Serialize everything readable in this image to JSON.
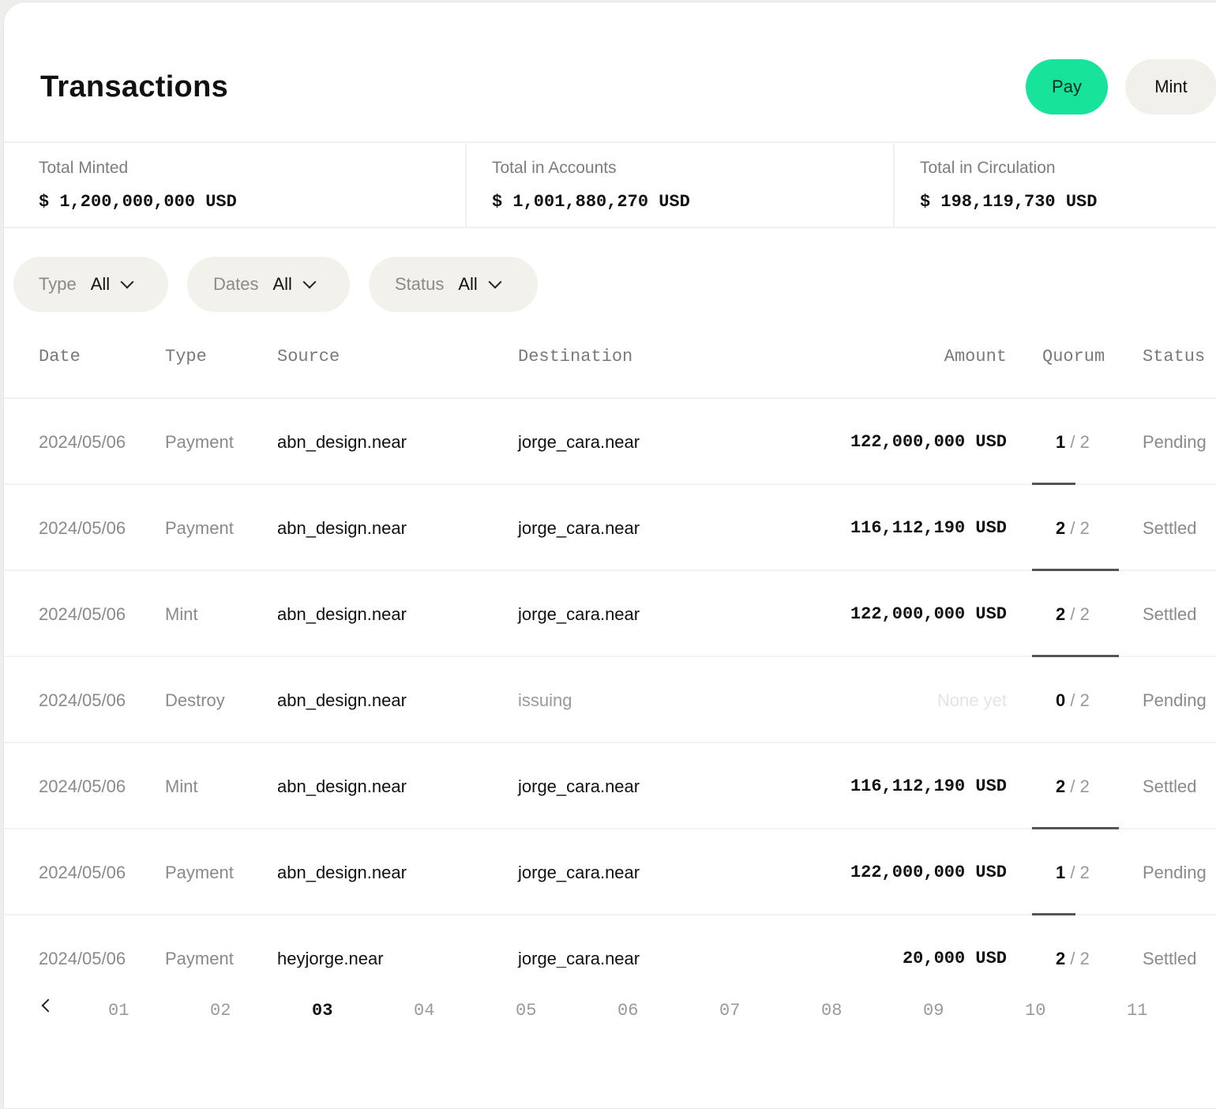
{
  "header": {
    "title": "Transactions",
    "pay_label": "Pay",
    "mint_label": "Mint"
  },
  "stats": [
    {
      "label": "Total Minted",
      "value": "$ 1,200,000,000 USD"
    },
    {
      "label": "Total in Accounts",
      "value": "$ 1,001,880,270 USD"
    },
    {
      "label": "Total in Circulation",
      "value": "$ 198,119,730 USD"
    }
  ],
  "filters": [
    {
      "label": "Type",
      "value": "All"
    },
    {
      "label": "Dates",
      "value": "All"
    },
    {
      "label": "Status",
      "value": "All"
    }
  ],
  "columns": {
    "date": "Date",
    "type": "Type",
    "source": "Source",
    "destination": "Destination",
    "amount": "Amount",
    "quorum": "Quorum",
    "status": "Status"
  },
  "rows": [
    {
      "date": "2024/05/06",
      "type": "Payment",
      "source": "abn_design.near",
      "destination": "jorge_cara.near",
      "amount": "122,000,000 USD",
      "quorum_num": "1",
      "quorum_den": "/ 2",
      "quorum_fraction": 0.5,
      "status": "Pending"
    },
    {
      "date": "2024/05/06",
      "type": "Payment",
      "source": "abn_design.near",
      "destination": "jorge_cara.near",
      "amount": "116,112,190 USD",
      "quorum_num": "2",
      "quorum_den": "/ 2",
      "quorum_fraction": 1.0,
      "status": "Settled"
    },
    {
      "date": "2024/05/06",
      "type": "Mint",
      "source": "abn_design.near",
      "destination": "jorge_cara.near",
      "amount": "122,000,000 USD",
      "quorum_num": "2",
      "quorum_den": "/ 2",
      "quorum_fraction": 1.0,
      "status": "Settled"
    },
    {
      "date": "2024/05/06",
      "type": "Destroy",
      "source": "abn_design.near",
      "destination": "issuing",
      "amount": "None yet",
      "quorum_num": "0",
      "quorum_den": "/ 2",
      "quorum_fraction": 0.0,
      "status": "Pending"
    },
    {
      "date": "2024/05/06",
      "type": "Mint",
      "source": "abn_design.near",
      "destination": "jorge_cara.near",
      "amount": "116,112,190 USD",
      "quorum_num": "2",
      "quorum_den": "/ 2",
      "quorum_fraction": 1.0,
      "status": "Settled"
    },
    {
      "date": "2024/05/06",
      "type": "Payment",
      "source": "abn_design.near",
      "destination": "jorge_cara.near",
      "amount": "122,000,000 USD",
      "quorum_num": "1",
      "quorum_den": "/ 2",
      "quorum_fraction": 0.5,
      "status": "Pending"
    },
    {
      "date": "2024/05/06",
      "type": "Payment",
      "source": "heyjorge.near",
      "destination": "jorge_cara.near",
      "amount": "20,000 USD",
      "quorum_num": "2",
      "quorum_den": "/ 2",
      "quorum_fraction": 1.0,
      "status": "Settled"
    }
  ],
  "pagination": {
    "pages": [
      "01",
      "02",
      "03",
      "04",
      "05",
      "06",
      "07",
      "08",
      "09",
      "10",
      "11"
    ],
    "current": "03"
  }
}
